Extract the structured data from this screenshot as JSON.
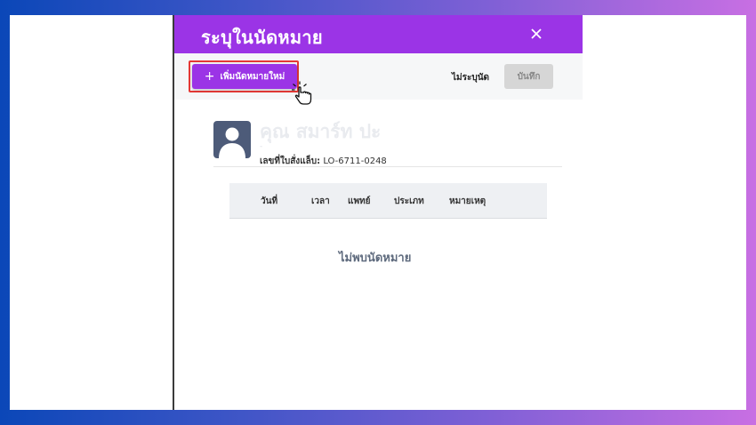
{
  "modal": {
    "title": "ระบุในนัดหมาย",
    "close_icon": "close-icon",
    "toolbar": {
      "add_button_label": "เพิ่มนัดหมายใหม่",
      "add_button_icon": "plus-icon",
      "no_record_label": "ไม่ระบุนัด",
      "save_label": "บันทึก"
    },
    "patient": {
      "name": "คุณ สมาร์ท ปะ",
      "sub": "-",
      "license_label": "เลขที่ใบสั่งแล็บ:",
      "license_value": "LO-6711-0248",
      "avatar_icon": "avatar-icon"
    },
    "table": {
      "headers": [
        "วันที่",
        "เวลา",
        "แพทย์",
        "ประเภท",
        "หมายเหตุ"
      ],
      "empty_message": "ไม่พบนัดหมาย"
    }
  },
  "colors": {
    "accent": "#9b34e6",
    "highlight": "#e53935",
    "save_disabled": "#d6d6d6"
  }
}
